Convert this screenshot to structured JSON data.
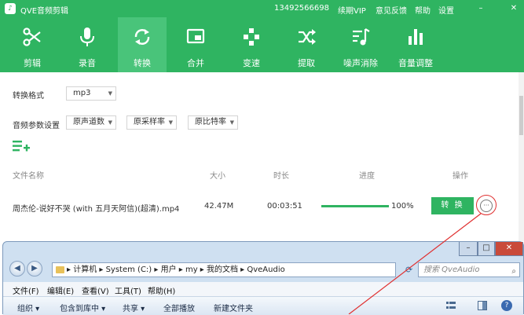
{
  "titlebar": {
    "app_title": "QVE音频剪辑",
    "phone": "13492566698",
    "links": [
      "续期VIP",
      "意见反馈",
      "帮助",
      "设置"
    ],
    "minimize": "–",
    "close": "✕"
  },
  "toolbar": {
    "tools": [
      {
        "label": "剪辑",
        "icon": "scissors-icon"
      },
      {
        "label": "录音",
        "icon": "microphone-icon"
      },
      {
        "label": "转换",
        "icon": "convert-cycle-icon"
      },
      {
        "label": "合并",
        "icon": "merge-icon"
      },
      {
        "label": "变速",
        "icon": "speed-icon"
      },
      {
        "label": "提取",
        "icon": "shuffle-icon"
      },
      {
        "label": "噪声消除",
        "icon": "noise-removal-icon"
      },
      {
        "label": "音量调整",
        "icon": "volume-bars-icon"
      }
    ],
    "active_index": 2
  },
  "options": {
    "format_label": "转换格式",
    "format_value": "mp3",
    "params_label": "音频参数设置",
    "channels_value": "原声道数",
    "samplerate_value": "原采样率",
    "bitrate_value": "原比特率"
  },
  "table": {
    "headers": {
      "name": "文件名称",
      "size": "大小",
      "duration": "时长",
      "progress": "进度",
      "action": "操作"
    },
    "rows": [
      {
        "name": "周杰伦-说好不哭 (with 五月天阿信)(超清).mp4",
        "size": "42.47M",
        "duration": "00:03:51",
        "progress_text": "100%",
        "progress": 1.0,
        "action": "转 换",
        "more": "···"
      }
    ]
  },
  "explorer": {
    "back": "◀",
    "forward": "▶",
    "address": "▸ 计算机 ▸ System (C:) ▸ 用户 ▸ my ▸ 我的文档 ▸ QveAudio",
    "search_placeholder": "搜索 QveAudio",
    "menu": [
      "文件(F)",
      "编辑(E)",
      "查看(V)",
      "工具(T)",
      "帮助(H)"
    ],
    "commands": [
      "组织 ▾",
      "包含到库中 ▾",
      "共享 ▾",
      "全部播放",
      "新建文件夹"
    ],
    "win_min": "–",
    "win_max": "□",
    "win_close": "✕"
  },
  "colors": {
    "brand_green": "#2fb461",
    "active_tab": "#49c47a",
    "annotation_red": "#e03030"
  }
}
